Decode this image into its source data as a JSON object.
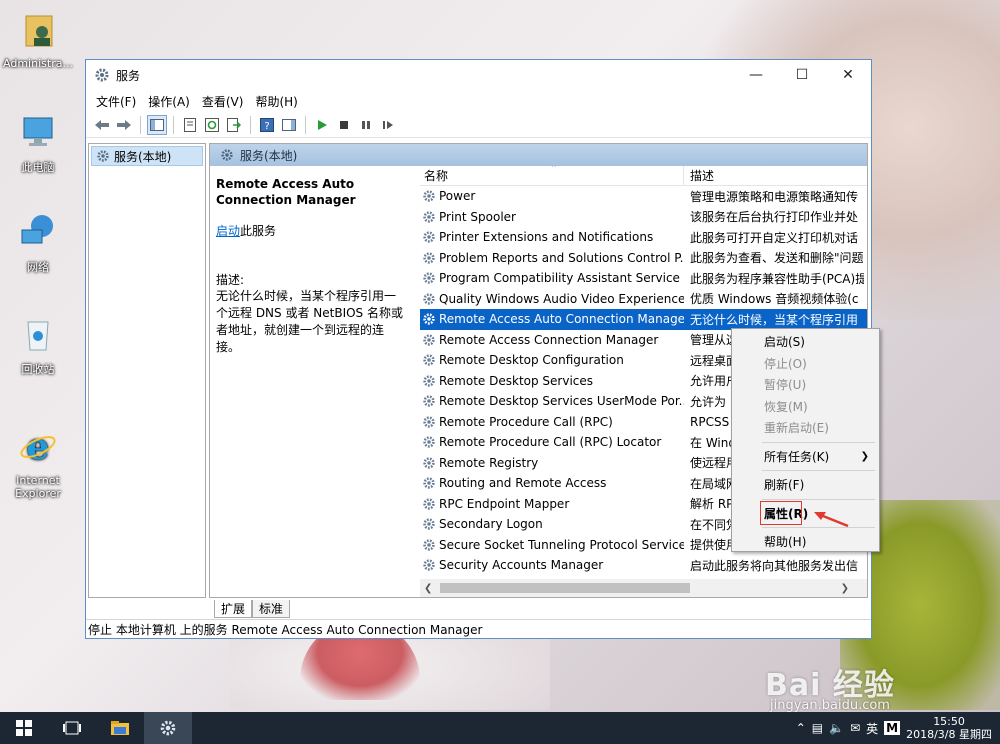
{
  "desktop": {
    "icons": [
      {
        "label": "Administra..."
      },
      {
        "label": "此电脑"
      },
      {
        "label": "网络"
      },
      {
        "label": "回收站"
      },
      {
        "label": "Internet\nExplorer"
      }
    ],
    "watermark": "Bai 经验",
    "watermark_url": "jingyan.baidu.com"
  },
  "window": {
    "title": "服务",
    "menu": [
      "文件(F)",
      "操作(A)",
      "查看(V)",
      "帮助(H)"
    ],
    "tree_root": "服务(本地)",
    "pane_header": "服务(本地)",
    "selected_name": "Remote Access Auto Connection Manager",
    "start_link": "启动",
    "start_suffix": "此服务",
    "desc_label": "描述:",
    "desc_text": "无论什么时候，当某个程序引用一个远程 DNS 或者 NetBIOS 名称或者地址，就创建一个到远程的连接。",
    "col_name": "名称",
    "col_desc": "描述",
    "services": [
      {
        "name": "Power",
        "desc": "管理电源策略和电源策略通知传"
      },
      {
        "name": "Print Spooler",
        "desc": "该服务在后台执行打印作业并处"
      },
      {
        "name": "Printer Extensions and Notifications",
        "desc": "此服务可打开自定义打印机对话"
      },
      {
        "name": "Problem Reports and Solutions Control P...",
        "desc": "此服务为查看、发送和删除\"问题"
      },
      {
        "name": "Program Compatibility Assistant Service",
        "desc": "此服务为程序兼容性助手(PCA)提"
      },
      {
        "name": "Quality Windows Audio Video Experience",
        "desc": "优质 Windows 音频视频体验(c"
      },
      {
        "name": "Remote Access Auto Connection Manager",
        "desc": "无论什么时候，当某个程序引用"
      },
      {
        "name": "Remote Access Connection Manager",
        "desc": "管理从这"
      },
      {
        "name": "Remote Desktop Configuration",
        "desc": "远程桌面"
      },
      {
        "name": "Remote Desktop Services",
        "desc": "允许用户"
      },
      {
        "name": "Remote Desktop Services UserMode Por...",
        "desc": "允许为"
      },
      {
        "name": "Remote Procedure Call (RPC)",
        "desc": "RPCSS"
      },
      {
        "name": "Remote Procedure Call (RPC) Locator",
        "desc": "在 Wind"
      },
      {
        "name": "Remote Registry",
        "desc": "使远程用"
      },
      {
        "name": "Routing and Remote Access",
        "desc": "在局域网"
      },
      {
        "name": "RPC Endpoint Mapper",
        "desc": "解析 RP"
      },
      {
        "name": "Secondary Logon",
        "desc": "在不同凭"
      },
      {
        "name": "Secure Socket Tunneling Protocol Service",
        "desc": "提供使用"
      },
      {
        "name": "Security Accounts Manager",
        "desc": "启动此服务将向其他服务发出信"
      }
    ],
    "tabs": [
      "扩展",
      "标准"
    ],
    "status": "停止 本地计算机 上的服务 Remote Access Auto Connection Manager"
  },
  "context_menu": {
    "items": [
      {
        "label": "启动(S)",
        "disabled": false
      },
      {
        "label": "停止(O)",
        "disabled": true
      },
      {
        "label": "暂停(U)",
        "disabled": true
      },
      {
        "label": "恢复(M)",
        "disabled": true
      },
      {
        "label": "重新启动(E)",
        "disabled": true
      },
      {
        "label": "所有任务(K)",
        "disabled": false,
        "submenu": true
      },
      {
        "label": "刷新(F)",
        "disabled": false
      },
      {
        "label": "属性(R)",
        "disabled": false,
        "highlighted": true
      },
      {
        "label": "帮助(H)",
        "disabled": false
      }
    ]
  },
  "taskbar": {
    "ime": "英",
    "ime2": "M",
    "time": "15:50",
    "date": "2018/3/8 星期四"
  },
  "colors": {
    "selection": "#0a64c8",
    "taskbar": "#1c2733",
    "highlight_box": "#e03a2e"
  }
}
